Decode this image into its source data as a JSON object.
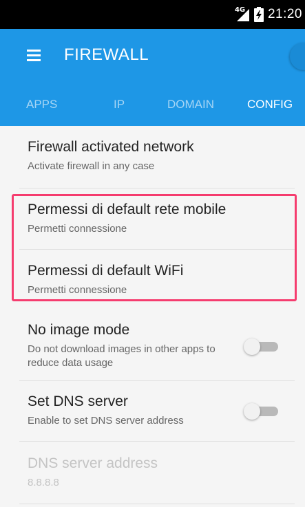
{
  "status_bar": {
    "network_type": "4G",
    "time": "21:20"
  },
  "appbar": {
    "title": "FIREWALL",
    "tabs": [
      {
        "label": "APPS",
        "active": false
      },
      {
        "label": "IP",
        "active": false
      },
      {
        "label": "DOMAIN",
        "active": false
      },
      {
        "label": "CONFIG",
        "active": true
      }
    ],
    "accent_color": "#1e97e6"
  },
  "settings": {
    "activated_network": {
      "title": "Firewall activated network",
      "subtitle": "Activate firewall in any case"
    },
    "default_mobile": {
      "title": "Permessi di default rete mobile",
      "subtitle": "Permetti connessione"
    },
    "default_wifi": {
      "title": "Permessi di default WiFi",
      "subtitle": "Permetti connessione"
    },
    "no_image_mode": {
      "title": "No image mode",
      "subtitle": "Do not download images in other apps to reduce data usage",
      "enabled": false
    },
    "set_dns": {
      "title": "Set DNS server",
      "subtitle": "Enable to set DNS server address",
      "enabled": false
    },
    "dns_address": {
      "title": "DNS server address",
      "value": "8.8.8.8",
      "disabled": true
    }
  },
  "highlight_color": "#f53c6e"
}
